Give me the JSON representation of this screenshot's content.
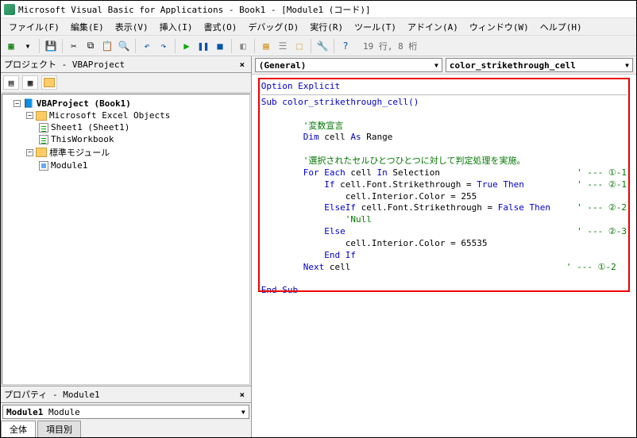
{
  "window": {
    "title": "Microsoft Visual Basic for Applications - Book1 - [Module1 (コード)]"
  },
  "menu": {
    "file": "ファイル(F)",
    "edit": "編集(E)",
    "view": "表示(V)",
    "insert": "挿入(I)",
    "format": "書式(O)",
    "debug": "デバッグ(D)",
    "run": "実行(R)",
    "tool": "ツール(T)",
    "addin": "アドイン(A)",
    "window": "ウィンドウ(W)",
    "help": "ヘルプ(H)"
  },
  "toolbar": {
    "status": "19 行, 8 桁"
  },
  "project_panel": {
    "title": "プロジェクト - VBAProject",
    "tree": {
      "root": "VBAProject (Book1)",
      "objects_folder": "Microsoft Excel Objects",
      "sheet1": "Sheet1 (Sheet1)",
      "thisworkbook": "ThisWorkbook",
      "modules_folder": "標準モジュール",
      "module1": "Module1"
    }
  },
  "properties_panel": {
    "title": "プロパティ - Module1",
    "object": "Module1",
    "object_type": "Module",
    "tab_all": "全体",
    "tab_cat": "項目別"
  },
  "code_pane": {
    "dropdown_left": "(General)",
    "dropdown_right": "color_strikethrough_cell",
    "lines": [
      {
        "t": "kw",
        "v": "Option Explicit"
      },
      {
        "t": "hr"
      },
      {
        "t": "kw",
        "v": "Sub color_strikethrough_cell()"
      },
      {
        "t": "blank"
      },
      {
        "t": "cm",
        "v": "        '変数宣言"
      },
      {
        "t": "mix",
        "v": "        ",
        "kw": "Dim",
        "rest": " cell ",
        "kw2": "As",
        "rest2": " Range"
      },
      {
        "t": "blank"
      },
      {
        "t": "cm",
        "v": "        '選択されたセルひとつひとつに対して判定処理を実施。"
      },
      {
        "t": "mix2",
        "pre": "        ",
        "kw": "For Each",
        "rest": " cell ",
        "kw2": "In",
        "rest2": " Selection",
        "cm": "                          ' --- ①-1"
      },
      {
        "t": "mix2",
        "pre": "            ",
        "kw": "If",
        "rest": " cell.Font.Strikethrough = ",
        "kw2": "True Then",
        "rest2": "",
        "cm": "          ' --- ②-1"
      },
      {
        "t": "plain",
        "v": "                cell.Interior.Color = 255"
      },
      {
        "t": "mix2",
        "pre": "            ",
        "kw": "ElseIf",
        "rest": " cell.Font.Strikethrough = ",
        "kw2": "False Then",
        "rest2": "",
        "cm": "     ' --- ②-2"
      },
      {
        "t": "cm",
        "v": "                'Null"
      },
      {
        "t": "mix2",
        "pre": "            ",
        "kw": "Else",
        "rest": "",
        "kw2": "",
        "rest2": "",
        "cm": "                                            ' --- ②-3"
      },
      {
        "t": "plain",
        "v": "                cell.Interior.Color = 65535"
      },
      {
        "t": "kw",
        "v": "            End If"
      },
      {
        "t": "mix2",
        "pre": "        ",
        "kw": "Next",
        "rest": " cell",
        "kw2": "",
        "rest2": "",
        "cm": "                                         ' --- ①-2"
      },
      {
        "t": "blank"
      },
      {
        "t": "kw",
        "v": "End Sub"
      }
    ]
  }
}
